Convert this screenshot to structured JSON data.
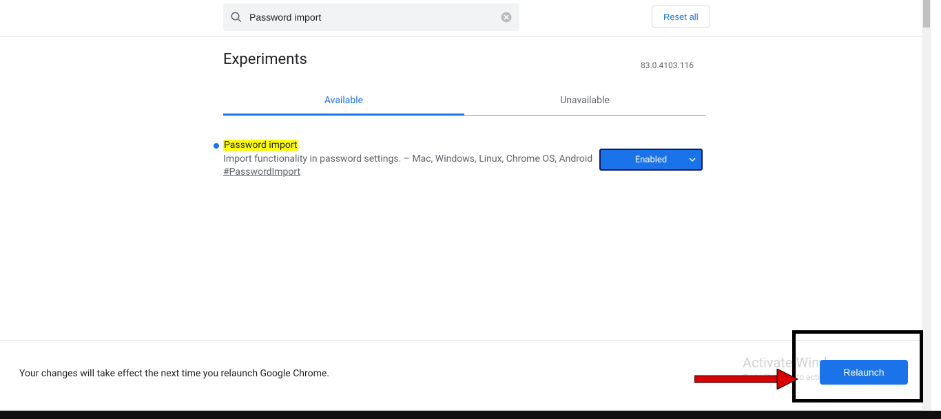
{
  "search": {
    "value": "Password import"
  },
  "reset_label": "Reset all",
  "page_title": "Experiments",
  "version": "83.0.4103.116",
  "tabs": {
    "available": "Available",
    "unavailable": "Unavailable"
  },
  "flag": {
    "title": "Password import",
    "description": "Import functionality in password settings. – Mac, Windows, Linux, Chrome OS, Android",
    "hash": "#PasswordImport",
    "selected_option": "Enabled"
  },
  "footer": {
    "message": "Your changes will take effect the next time you relaunch Google Chrome.",
    "relaunch_label": "Relaunch"
  },
  "watermark": {
    "line1": "Activate Windows",
    "line2": "Go to Settings to activate Windows."
  }
}
